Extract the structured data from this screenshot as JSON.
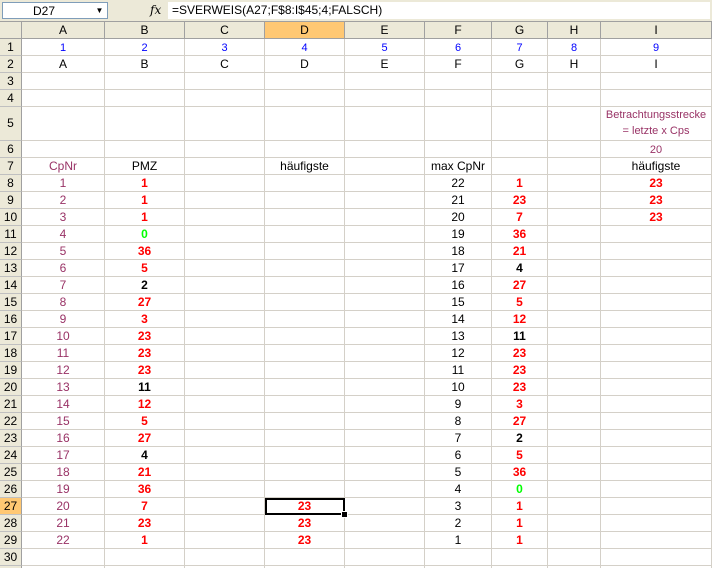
{
  "formula_bar": {
    "name_box": "D27",
    "fx": "fx",
    "formula": "=SVERWEIS(A27;F$8:I$45;4;FALSCH)"
  },
  "columns": [
    "A",
    "B",
    "C",
    "D",
    "E",
    "F",
    "G",
    "H",
    "I"
  ],
  "selected_column": "D",
  "selected_row": "27",
  "rows": [
    "1",
    "2",
    "3",
    "4",
    "5",
    "6",
    "7",
    "8",
    "9",
    "10",
    "11",
    "12",
    "13",
    "14",
    "15",
    "16",
    "17",
    "18",
    "19",
    "20",
    "21",
    "22",
    "23",
    "24",
    "25",
    "26",
    "27",
    "28",
    "29",
    "30",
    "31"
  ],
  "row1": [
    "1",
    "2",
    "3",
    "4",
    "5",
    "6",
    "7",
    "8",
    "9"
  ],
  "row2": [
    "A",
    "B",
    "C",
    "D",
    "E",
    "F",
    "G",
    "H",
    "I"
  ],
  "notes": {
    "i5_line1": "Betrachtungsstrecke",
    "i5_line2": "= letzte x Cps",
    "i6": "20"
  },
  "headers": {
    "a7": "CpNr",
    "b7": "PMZ",
    "d7": "häufigste",
    "f7": "max CpNr",
    "i7": "häufigste"
  },
  "col_a": [
    "1",
    "2",
    "3",
    "4",
    "5",
    "6",
    "7",
    "8",
    "9",
    "10",
    "11",
    "12",
    "13",
    "14",
    "15",
    "16",
    "17",
    "18",
    "19",
    "20",
    "21",
    "22"
  ],
  "col_b": [
    {
      "v": "1",
      "c": "red"
    },
    {
      "v": "1",
      "c": "red"
    },
    {
      "v": "1",
      "c": "red"
    },
    {
      "v": "0",
      "c": "green"
    },
    {
      "v": "36",
      "c": "red"
    },
    {
      "v": "5",
      "c": "red"
    },
    {
      "v": "2",
      "c": "black"
    },
    {
      "v": "27",
      "c": "red"
    },
    {
      "v": "3",
      "c": "red"
    },
    {
      "v": "23",
      "c": "red"
    },
    {
      "v": "23",
      "c": "red"
    },
    {
      "v": "23",
      "c": "red"
    },
    {
      "v": "11",
      "c": "black"
    },
    {
      "v": "12",
      "c": "red"
    },
    {
      "v": "5",
      "c": "red"
    },
    {
      "v": "27",
      "c": "red"
    },
    {
      "v": "4",
      "c": "black"
    },
    {
      "v": "21",
      "c": "red"
    },
    {
      "v": "36",
      "c": "red"
    },
    {
      "v": "7",
      "c": "red"
    },
    {
      "v": "23",
      "c": "red"
    },
    {
      "v": "1",
      "c": "red"
    }
  ],
  "col_d": [
    {
      "row": 27,
      "v": "23"
    },
    {
      "row": 28,
      "v": "23"
    },
    {
      "row": 29,
      "v": "23"
    }
  ],
  "col_f": [
    "22",
    "21",
    "20",
    "19",
    "18",
    "17",
    "16",
    "15",
    "14",
    "13",
    "12",
    "11",
    "10",
    "9",
    "8",
    "7",
    "6",
    "5",
    "4",
    "3",
    "2",
    "1"
  ],
  "col_g": [
    {
      "v": "1",
      "c": "red"
    },
    {
      "v": "23",
      "c": "red"
    },
    {
      "v": "7",
      "c": "red"
    },
    {
      "v": "36",
      "c": "red"
    },
    {
      "v": "21",
      "c": "red"
    },
    {
      "v": "4",
      "c": "black"
    },
    {
      "v": "27",
      "c": "red"
    },
    {
      "v": "5",
      "c": "red"
    },
    {
      "v": "12",
      "c": "red"
    },
    {
      "v": "11",
      "c": "black"
    },
    {
      "v": "23",
      "c": "red"
    },
    {
      "v": "23",
      "c": "red"
    },
    {
      "v": "23",
      "c": "red"
    },
    {
      "v": "3",
      "c": "red"
    },
    {
      "v": "27",
      "c": "red"
    },
    {
      "v": "2",
      "c": "black"
    },
    {
      "v": "5",
      "c": "red"
    },
    {
      "v": "36",
      "c": "red"
    },
    {
      "v": "0",
      "c": "green"
    },
    {
      "v": "1",
      "c": "red"
    },
    {
      "v": "1",
      "c": "red"
    },
    {
      "v": "1",
      "c": "red"
    }
  ],
  "col_i": [
    "23",
    "23",
    "23"
  ],
  "colors": {
    "red": "#ff0000",
    "green": "#00ff00",
    "purple": "#993366",
    "blue": "#0000ff",
    "header_bg": "#ece9d8",
    "selected_header": "#ffc873"
  }
}
